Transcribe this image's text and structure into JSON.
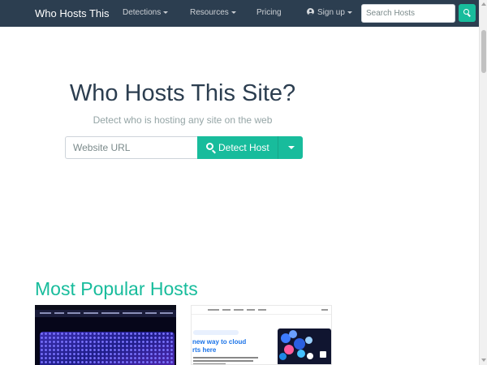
{
  "navbar": {
    "brand": "Who Hosts This",
    "links": {
      "detections": "Detections",
      "resources": "Resources",
      "pricing": "Pricing",
      "signup": "Sign up"
    },
    "search": {
      "placeholder": "Search Hosts"
    }
  },
  "hero": {
    "title": "Who Hosts This Site?",
    "subtitle": "Detect who is hosting any site on the web",
    "url_input": {
      "placeholder": "Website URL",
      "value": ""
    },
    "detect_button": "Detect Host"
  },
  "popular": {
    "title": "Most Popular Hosts",
    "thumb2_headline": "new way to cloud\nrts here"
  },
  "colors": {
    "navbar": "#2c3e50",
    "accent": "#18bc9c",
    "muted": "#95a5a6"
  },
  "icons": [
    "search-icon",
    "user-icon",
    "chevron-down-icon"
  ]
}
